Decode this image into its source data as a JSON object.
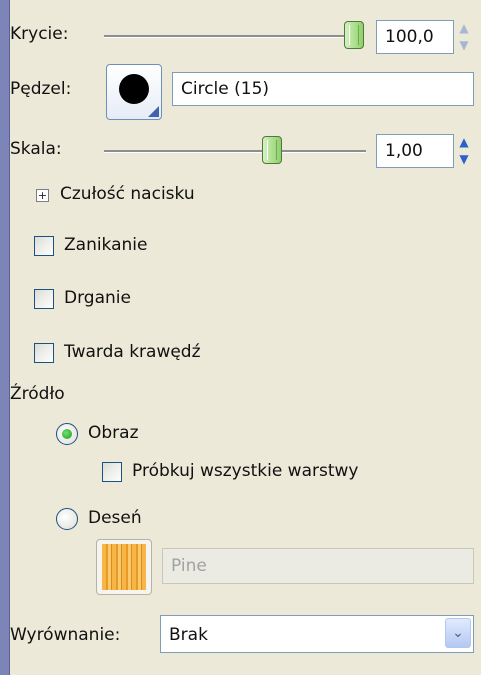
{
  "opacity": {
    "label": "Krycie:",
    "value": "100,0",
    "slider_fraction": 1.0
  },
  "brush": {
    "label": "Pędzel:",
    "name": "Circle (15)"
  },
  "scale": {
    "label": "Skala:",
    "value": "1,00",
    "slider_fraction": 0.62
  },
  "pressure_sensitivity": {
    "label": "Czułość nacisku",
    "expander": "+"
  },
  "options": {
    "fade": {
      "label": "Zanikanie",
      "checked": false
    },
    "jitter": {
      "label": "Drganie",
      "checked": false
    },
    "hard_edge": {
      "label": "Twarda krawędź",
      "checked": false
    }
  },
  "source": {
    "label": "Źródło",
    "image": {
      "label": "Obraz",
      "selected": true
    },
    "sample_all_layers": {
      "label": "Próbkuj wszystkie warstwy",
      "checked": false
    },
    "pattern": {
      "label": "Deseń",
      "selected": false
    },
    "pattern_name": "Pine"
  },
  "alignment": {
    "label": "Wyrównanie:",
    "value": "Brak"
  }
}
